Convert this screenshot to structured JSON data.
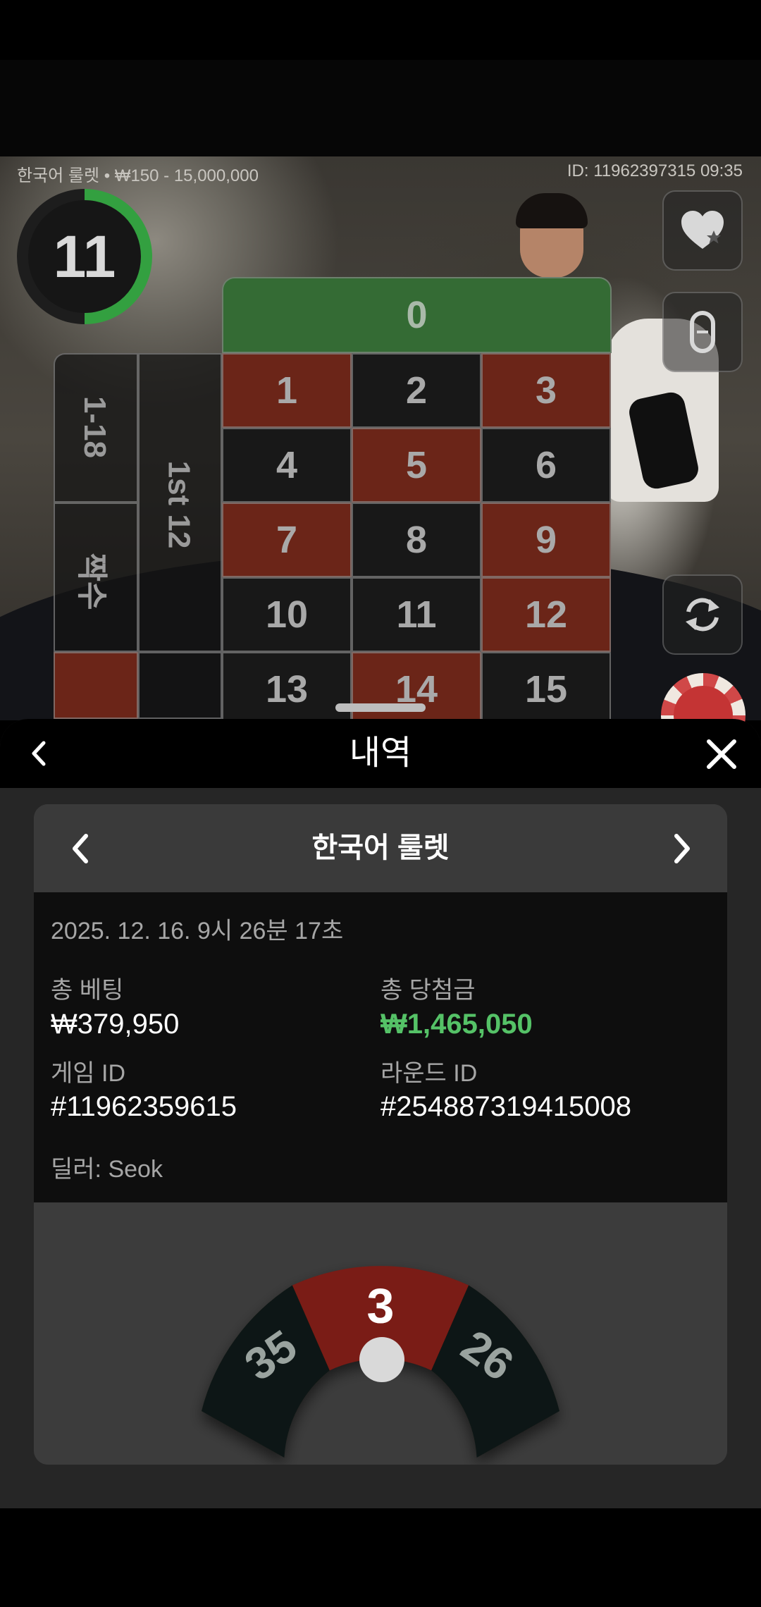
{
  "game_header": {
    "table_info": "한국어 룰렛 • ₩150 - 15,000,000",
    "round_info": "ID: 11962397315  09:35",
    "timer_value": "11",
    "timer_progress": 0.5
  },
  "board": {
    "zero": "0",
    "numbers": [
      {
        "n": "1",
        "color": "red"
      },
      {
        "n": "2",
        "color": "black"
      },
      {
        "n": "3",
        "color": "red"
      },
      {
        "n": "4",
        "color": "black"
      },
      {
        "n": "5",
        "color": "red"
      },
      {
        "n": "6",
        "color": "black"
      },
      {
        "n": "7",
        "color": "red"
      },
      {
        "n": "8",
        "color": "black"
      },
      {
        "n": "9",
        "color": "red"
      },
      {
        "n": "10",
        "color": "black"
      },
      {
        "n": "11",
        "color": "black"
      },
      {
        "n": "12",
        "color": "red"
      },
      {
        "n": "13",
        "color": "black"
      },
      {
        "n": "14",
        "color": "red"
      },
      {
        "n": "15",
        "color": "black"
      }
    ],
    "low_bet": "1-18",
    "dozen_bet": "1st 12",
    "even_bet": "짝수"
  },
  "side_buttons": {
    "favorites_icon": "heart-star-icon",
    "racetrack_icon": "racetrack-icon",
    "refresh_icon": "refresh-icon",
    "chip_icon": "chip-icon"
  },
  "history": {
    "title": "내역",
    "game_name": "한국어 룰렛",
    "datetime": "2025. 12. 16. 9시 26분 17초",
    "total_bet_label": "총 베팅",
    "total_bet_value": "₩379,950",
    "total_win_label": "총 당첨금",
    "total_win_value": "₩1,465,050",
    "game_id_label": "게임 ID",
    "game_id_value": "#11962359615",
    "round_id_label": "라운드 ID",
    "round_id_value": "#254887319415008",
    "dealer": "딜러: Seok",
    "result": {
      "left": "35",
      "center": "3",
      "right": "26"
    }
  },
  "colors": {
    "win_green": "#55c267",
    "roulette_red": "#6b2518",
    "result_red": "#7a1a12",
    "result_dark": "#0c1512",
    "zero_green": "#346b34"
  }
}
